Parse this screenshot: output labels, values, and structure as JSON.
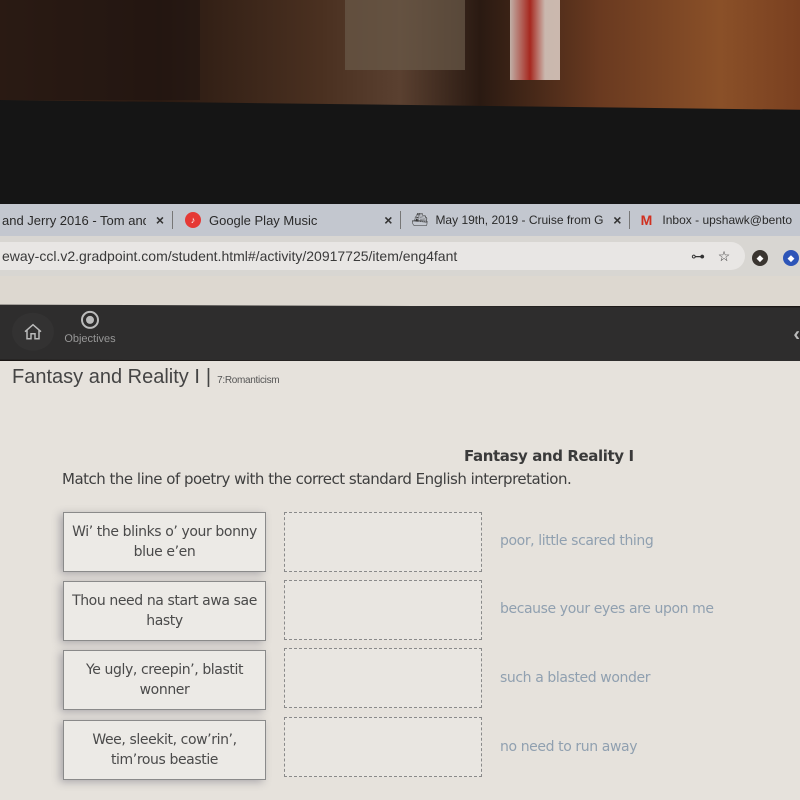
{
  "browser": {
    "tabs": [
      {
        "title": "and Jerry 2016 - Tom and",
        "icon": "generic",
        "close": "×"
      },
      {
        "title": "Google Play Music",
        "icon": "google-play-music-icon",
        "close": "×"
      },
      {
        "title": "May 19th, 2019 - Cruise from G",
        "icon": "ship-icon",
        "close": "×"
      },
      {
        "title": "Inbox - upshawk@bento",
        "icon": "gmail-icon",
        "close": ""
      }
    ],
    "url": "eway-ccl.v2.gradpoint.com/student.html#/activity/20917725/item/eng4fant",
    "icons": {
      "key": "⊶",
      "star": "☆"
    }
  },
  "appnav": {
    "home_icon": "⌂",
    "objectives_label": "Objectives",
    "collapse_icon": "‹"
  },
  "page": {
    "title": "Fantasy and Reality I",
    "separator": "|",
    "subtitle": "7:Romanticism"
  },
  "question": {
    "title": "Fantasy and Reality I",
    "instructions": "Match the line of poetry with the correct standard English interpretation.",
    "poem_lines": [
      "Wi’ the blinks o’ your bonny blue e’en",
      "Thou need na start awa sae hasty",
      "Ye ugly, creepin’, blastit wonner",
      "Wee, sleekit, cow’rin’, tim’rous beastie"
    ],
    "answers": [
      "poor, little scared thing",
      "because your eyes are upon me",
      "such a blasted wonder",
      "no need to run away"
    ],
    "drop_zones": [
      "",
      "",
      "",
      ""
    ]
  },
  "colors": {
    "answer_text": "#90a0b0",
    "nav_bar": "#2e2d2d",
    "content_bg": "#e6e2dc"
  }
}
